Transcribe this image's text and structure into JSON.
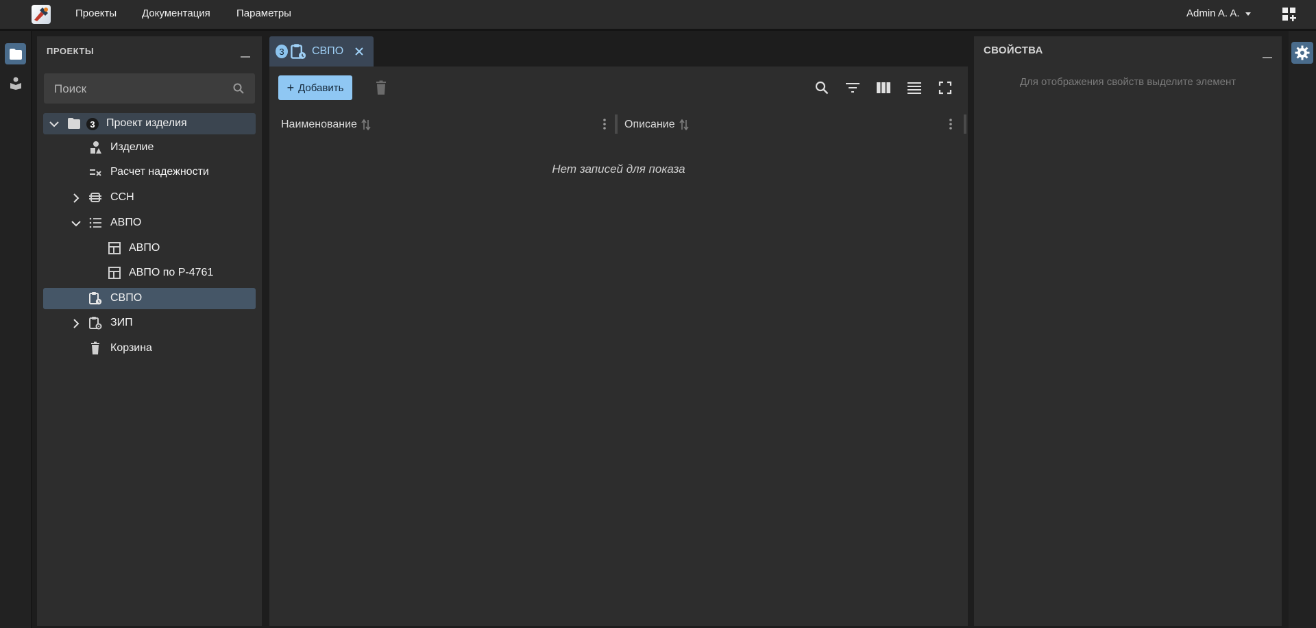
{
  "topbar": {
    "menu": [
      "Проекты",
      "Документация",
      "Параметры"
    ],
    "user": "Admin A. A."
  },
  "projects": {
    "title": "ПРОЕКТЫ",
    "search_placeholder": "Поиск",
    "tree": [
      {
        "label": "Проект изделия",
        "badge": "3",
        "expanded": true,
        "icon": "folder-icon"
      },
      {
        "label": "Изделие",
        "icon": "product-icon"
      },
      {
        "label": "Расчет надежности",
        "icon": "reliability-calc-icon"
      },
      {
        "label": "ССН",
        "expanded": false,
        "icon": "structure-icon"
      },
      {
        "label": "АВПО",
        "expanded": true,
        "icon": "list-icon"
      },
      {
        "label": "АВПО",
        "icon": "table-icon"
      },
      {
        "label": "АВПО по Р-4761",
        "icon": "table-icon"
      },
      {
        "label": "СВПО",
        "icon": "clipboard-clock-icon",
        "selected": true
      },
      {
        "label": "ЗИП",
        "expanded": false,
        "icon": "clipboard-gear-icon"
      },
      {
        "label": "Корзина",
        "icon": "trash-icon"
      }
    ]
  },
  "tab": {
    "badge": "3",
    "label": "СВПО"
  },
  "toolbar": {
    "add_label": "Добавить"
  },
  "table": {
    "columns": [
      "Наименование",
      "Описание"
    ],
    "empty_message": "Нет записей для показа"
  },
  "properties": {
    "title": "СВОЙСТВА",
    "hint": "Для отображения свойств выделите элемент"
  },
  "colors": {
    "accent": "#8fc7f3",
    "selected_row": "#455667",
    "panel_bg": "#2d2d2d",
    "app_bg": "#1d1d1d"
  }
}
